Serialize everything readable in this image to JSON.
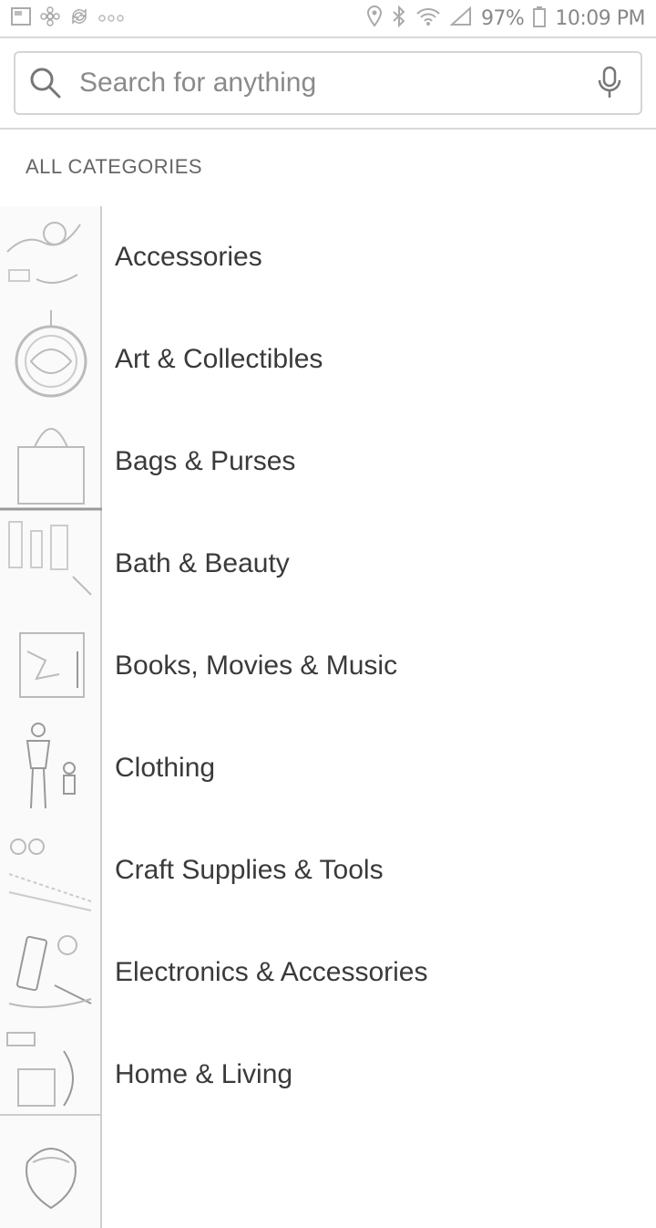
{
  "status_bar": {
    "left_icons": [
      "photo-icon",
      "pinwheel-icon",
      "sync-icon",
      "more-dots-icon"
    ],
    "right_icons": [
      "location-icon",
      "bluetooth-icon",
      "wifi-icon",
      "signal-icon",
      "battery-icon"
    ],
    "battery": "97%",
    "time": "10:09 PM"
  },
  "search": {
    "placeholder": "Search for anything",
    "value": "",
    "icons": [
      "search-icon",
      "microphone-icon"
    ]
  },
  "section_title": "ALL CATEGORIES",
  "categories": [
    {
      "label": "Accessories"
    },
    {
      "label": "Art & Collectibles"
    },
    {
      "label": "Bags & Purses"
    },
    {
      "label": "Bath & Beauty"
    },
    {
      "label": "Books, Movies & Music"
    },
    {
      "label": "Clothing"
    },
    {
      "label": "Craft Supplies & Tools"
    },
    {
      "label": "Electronics & Accessories"
    },
    {
      "label": "Home & Living"
    },
    {
      "label": ""
    }
  ],
  "colors": {
    "background": "#ffffff",
    "text": "#3a3a3a",
    "muted": "#888888",
    "border": "#d4d4d4"
  }
}
